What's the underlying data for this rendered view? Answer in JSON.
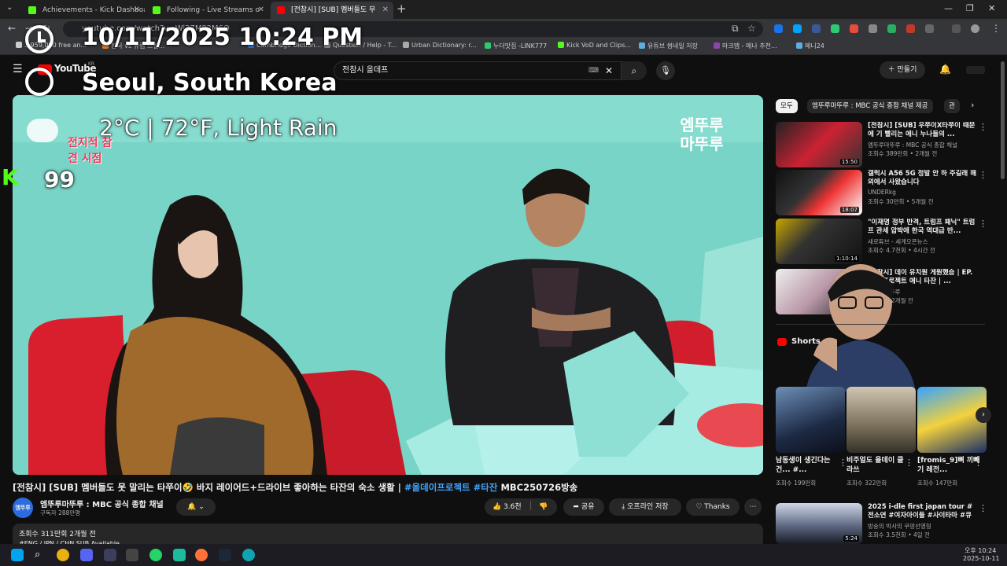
{
  "tabs": [
    {
      "label": "Achievements - Kick Dashboard",
      "color": "#53fc18"
    },
    {
      "label": "Following - Live Streams o",
      "color": "#53fc18"
    },
    {
      "label": "[전참시] [SUB] 멤버들도 무",
      "color": "#ff0000"
    }
  ],
  "address": {
    "url": "youtube.com/watch?v=Wi27MP2M6Q"
  },
  "bookmarks": [
    "3,959,000 free an...",
    "한국 vs 유럽 스킬...",
    "Cambridge Diction...",
    "Question / Help - T...",
    "Urban Dictionary: r...",
    "누더맛집 -LINK777",
    "Kick VoD and Clips...",
    "유튜브 썸네일 저장",
    "마크맵 - 메나 추천...",
    "메니24"
  ],
  "youtube": {
    "logo": "YouTube",
    "region": "KR",
    "search_value": "전참시 올데프",
    "create_label": "만들기"
  },
  "overlay": {
    "datetime": "10/11/2025 10:24 PM",
    "location": "Seoul, South Korea",
    "weather": "2°C | 72°F, Light Rain",
    "kick_count": "99",
    "show_logo": "전지적 참견 시점",
    "channel_watermark": "엠뚜루 마뚜루"
  },
  "video": {
    "title": "[전참시] [SUB] 멤버들도 못 말리는 타쭈이🤣 바지 레이어드+드라이브 좋아하는 타잔의 숙소 생활 |",
    "tags": "#올데이프로젝트 #타잔",
    "title_tail": "MBC250726방송",
    "channel_name": "엠뚜루마뚜루 : MBC 공식 종합 채널",
    "channel_avatar": "엠뚜루",
    "subscribers": "구독자 288만명",
    "likes": "3.6천",
    "share": "공유",
    "offline": "오프라인 저장",
    "thanks": "Thanks",
    "views_line": "조회수 311만회  2개월 전",
    "desc_line": "#ENG / JPN / CHN SUB Available"
  },
  "chips": [
    "모두",
    "엠뚜루마뚜루 : MBC 공식 종합 채널 제공",
    "관"
  ],
  "recommendations": [
    {
      "title": "[전참시] [SUB] 우쭈이X타쭈이 때문에 기 빨리는 애니 누나들의 ...",
      "channel": "엠뚜루마뚜루 : MBC 공식 종합 채널",
      "views": "조회수 389만회 • 2개월 전",
      "duration": "15:50"
    },
    {
      "title": "갤럭시 A56 5G 정발 안 하 주길래 해외에서 사왔습니다",
      "channel": "UNDERkg",
      "views": "조회수 30만회 • 5개월 전",
      "duration": "18:07"
    },
    {
      "title": "\"이재명 정부 반격, 트럼프 패닉\" 트럼프 관세 압박에 한국 역대급 반...",
      "channel": "새로튜브 - 세계오픈뉴스",
      "views": "조회수 4.7천회 • 4시간 전",
      "duration": "1:10:14"
    },
    {
      "title": "[전참시] 데이 유치원 게원했슴 | EP. 애니 프로젝트 애니 타잔 | ...",
      "channel": "엠뚜루마뚜루",
      "views": "조회수 • 2개월 전",
      "duration": ""
    }
  ],
  "shorts_header": "Shorts",
  "shorts": [
    {
      "title": "남동생이 생긴다는 건... #...",
      "views": "조회수 199만회"
    },
    {
      "title": "비주얼도 올데이 클라쓰",
      "views": "조회수 322만회"
    },
    {
      "title": "[fromis_9]뼈 끼빼기 레전...",
      "views": "조회수 147만회"
    }
  ],
  "bottom_reco": {
    "title": "2025 i-dle first japan tour #전소연 #여자아이들 #사이타마 #큐브...",
    "channel": "방송의 박사의 쿠팡선영형",
    "views": "조회수 3.5천회 • 4일 전",
    "duration": "5:24"
  },
  "taskbar": {
    "time": "오후 10:24",
    "date": "2025-10-11"
  }
}
